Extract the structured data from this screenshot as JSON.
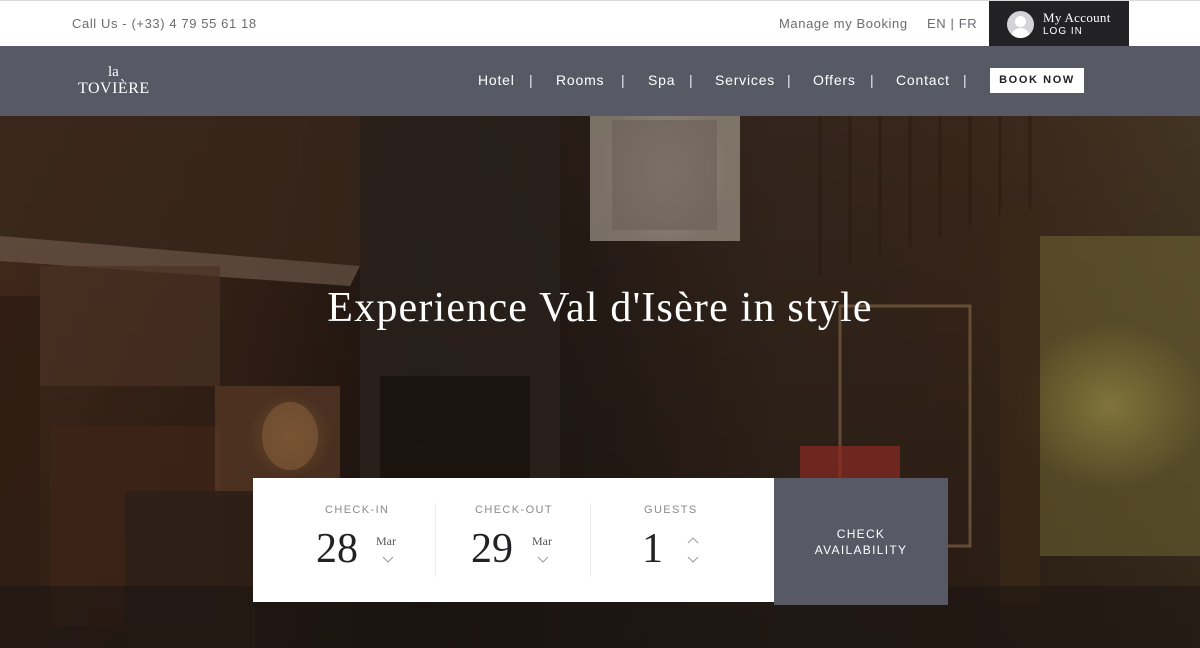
{
  "topbar": {
    "call": "Call Us - (+33) 4 79 55 61 18",
    "manage_booking": "Manage my Booking",
    "lang_en": "EN",
    "lang_sep": "|",
    "lang_fr": "FR",
    "account_title": "My Account",
    "account_login": "LOG IN"
  },
  "logo": {
    "line1": "la",
    "line2": "TOVIÈRE"
  },
  "nav": {
    "items": [
      {
        "label": "Hotel"
      },
      {
        "label": "Rooms"
      },
      {
        "label": "Spa"
      },
      {
        "label": "Services"
      },
      {
        "label": "Offers"
      },
      {
        "label": "Contact"
      }
    ],
    "separator": "|",
    "book_now": "BOOK NOW"
  },
  "hero": {
    "title": "Experience Val d'Isère in style"
  },
  "booking": {
    "checkin": {
      "label": "CHECK-IN",
      "day": "28",
      "month": "Mar"
    },
    "checkout": {
      "label": "CHECK-OUT",
      "day": "29",
      "month": "Mar"
    },
    "guests": {
      "label": "GUESTS",
      "value": "1"
    },
    "check_availability": {
      "line1": "CHECK",
      "line2": "AVAILABILITY"
    }
  },
  "colors": {
    "nav_bg": "#575965",
    "account_bg": "#222225",
    "text_muted": "#6c6c72",
    "accent_button": "#575965"
  },
  "icons": [
    "user-avatar-icon",
    "chevron-down-icon",
    "chevron-up-icon"
  ]
}
